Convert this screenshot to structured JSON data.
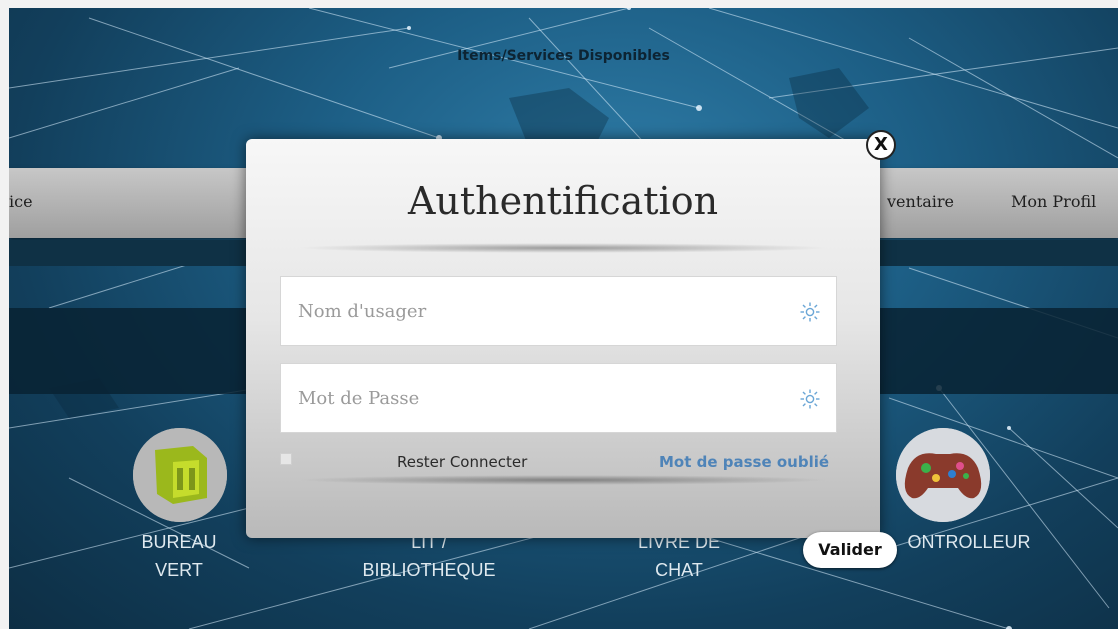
{
  "header": {
    "title": "Items/Services Disponibles"
  },
  "nav": {
    "left_partial": "ice",
    "inventory_partial": "ventaire",
    "profile": "Mon Profil"
  },
  "items": [
    {
      "label_line1": "BUREAU",
      "label_line2": "VERT"
    },
    {
      "label_line1": "LIT /",
      "label_line2": "BIBLIOTHEQUE"
    },
    {
      "label_line1": "LIVRE DE",
      "label_line2": "CHAT"
    },
    {
      "label_line1": "ONTROLLEUR",
      "label_line2": ""
    }
  ],
  "modal": {
    "title": "Authentification",
    "username_placeholder": "Nom d'usager",
    "password_placeholder": "Mot de Passe",
    "field_icon": "sun-icon",
    "remember_label": "Rester Connecter",
    "forgot_label": "Mot de passe oublié",
    "close_label": "X",
    "submit_label": "Valider"
  },
  "colors": {
    "background": "#1d5f86",
    "link": "#4f84b8",
    "navbar": "#b3b3b3"
  }
}
